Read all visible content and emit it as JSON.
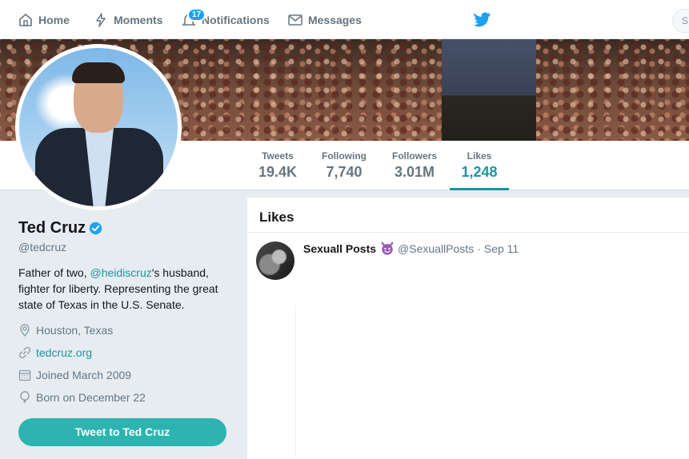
{
  "nav": {
    "home": "Home",
    "moments": "Moments",
    "notifications": "Notifications",
    "notification_count": "17",
    "messages": "Messages",
    "search_stub": "S"
  },
  "profile": {
    "name": "Ted Cruz",
    "handle": "@tedcruz",
    "bio_before": "Father of two, ",
    "bio_mention": "@heidiscruz",
    "bio_after": "'s husband, fighter for liberty. Representing the great state of Texas in the U.S. Senate.",
    "location": "Houston, Texas",
    "url": "tedcruz.org",
    "joined": "Joined March 2009",
    "born": "Born on December 22",
    "tweet_to_button": "Tweet to Ted Cruz"
  },
  "stats": {
    "tweets_label": "Tweets",
    "tweets_value": "19.4K",
    "following_label": "Following",
    "following_value": "7,740",
    "followers_label": "Followers",
    "followers_value": "3.01M",
    "likes_label": "Likes",
    "likes_value": "1,248"
  },
  "timeline": {
    "title": "Likes",
    "tweet": {
      "author_name": "Sexuall Posts",
      "author_handle": "@SexuallPosts",
      "separator": "·",
      "date": "Sep 11"
    }
  },
  "colors": {
    "accent": "#1b95a0",
    "button": "#2db3b0",
    "badge": "#1da1f2",
    "verified": "#1da1f2"
  },
  "icons": {
    "home": "home-icon",
    "moments": "lightning-icon",
    "notifications": "bell-icon",
    "messages": "envelope-icon",
    "brand": "twitter-bird-icon",
    "location": "location-pin-icon",
    "url": "link-icon",
    "joined": "calendar-icon",
    "born": "balloon-icon",
    "verified": "verified-badge-icon",
    "emoji": "devil-emoji-icon"
  }
}
